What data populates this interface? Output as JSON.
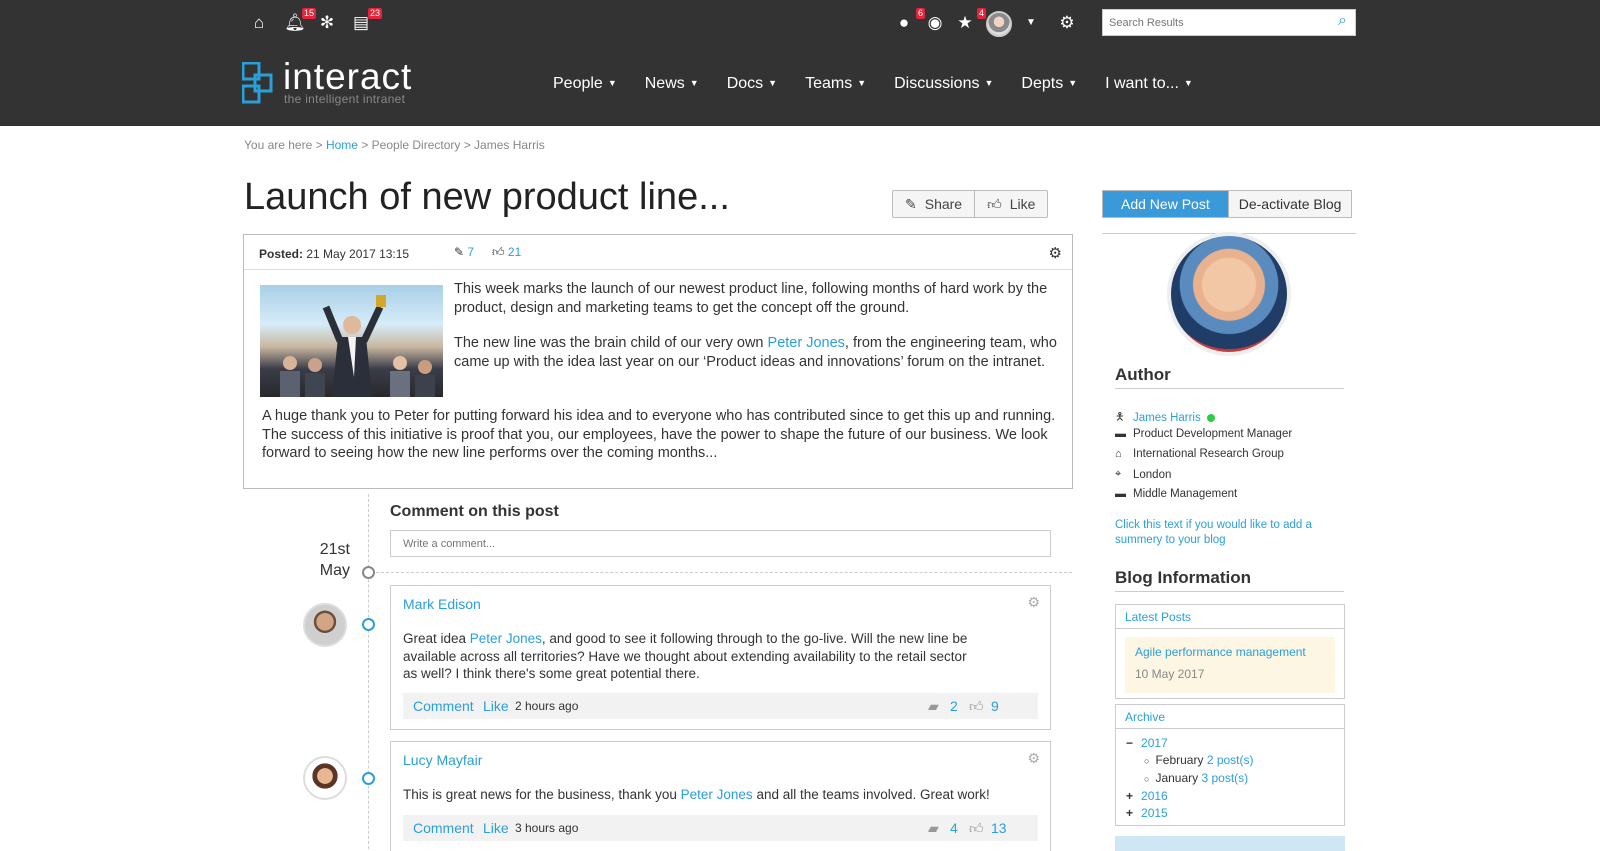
{
  "topbar": {
    "notifications_count": "15",
    "tasks_count": "23",
    "alerts_count": "6",
    "favourites_count": "4",
    "search_placeholder": "Search Results"
  },
  "logo": {
    "name": "interact",
    "tagline": "the intelligent intranet"
  },
  "nav": [
    {
      "label": "People"
    },
    {
      "label": "News"
    },
    {
      "label": "Docs"
    },
    {
      "label": "Teams"
    },
    {
      "label": "Discussions"
    },
    {
      "label": "Depts"
    },
    {
      "label": "I want to..."
    }
  ],
  "breadcrumb": {
    "prefix": "You are here >",
    "home": "Home",
    "rest": "> People Directory > James Harris"
  },
  "post": {
    "title": "Launch of new product line...",
    "share_label": "Share",
    "like_label": "Like",
    "posted_label": "Posted:",
    "posted_date": "21 May 2017 13:15",
    "edits": "7",
    "likes": "21",
    "para1": "This week marks the launch of our newest product line, following months of hard work by the product, design and marketing teams to get the concept off the ground.",
    "para2_a": "The new line was the brain child of our very own ",
    "para2_link": "Peter Jones",
    "para2_b": ", from the engineering team, who came up with the idea last year on our ‘Product ideas and innovations’ forum on the intranet.",
    "para3": "A huge thank you to Peter for putting forward his idea and to everyone who has contributed since to get this up and running. The success of this initiative is proof that you, our employees, have the power to shape the future of our business. We look forward to seeing how the new line performs over the coming months..."
  },
  "comments_section": {
    "heading": "Comment on this post",
    "placeholder": "Write a comment...",
    "date_day": "21st",
    "date_month": "May",
    "items": [
      {
        "author": "Mark Edison",
        "text_a": "Great idea ",
        "link": "Peter Jones",
        "text_b": ", and good to see it following through to the go-live. Will the new line be available across all territories? Have we thought about extending availability to the retail sector as well? I think there's some great potential there.",
        "comment_label": "Comment",
        "like_label": "Like",
        "time": "2 hours ago",
        "replies": "2",
        "likes": "9"
      },
      {
        "author": "Lucy Mayfair",
        "text_a": "This is great news for the business, thank you ",
        "link": "Peter Jones",
        "text_b": " and all the teams involved. Great work!",
        "comment_label": "Comment",
        "like_label": "Like",
        "time": "3 hours ago",
        "replies": "4",
        "likes": "13"
      }
    ]
  },
  "sidebar": {
    "add_post": "Add New Post",
    "deactivate": "De-activate Blog",
    "author_heading": "Author",
    "author": {
      "name": "James Harris",
      "role": "Product Development Manager",
      "company": "International Research Group",
      "location": "London",
      "level": "Middle Management"
    },
    "summary_hint": "Click this text if you would like to add a summery to your blog",
    "blog_info_heading": "Blog Information",
    "latest_posts_label": "Latest Posts",
    "latest_post": {
      "title": "Agile performance management",
      "date": "10 May 2017"
    },
    "archive_label": "Archive",
    "archive": {
      "y2017": "2017",
      "feb": "February",
      "feb_count": "2 post(s)",
      "jan": "January",
      "jan_count": "3 post(s)",
      "y2016": "2016",
      "y2015": "2015"
    }
  },
  "colors": {
    "topbar": "#333333",
    "accent": "#2a9fd8",
    "online": "#2ecc40",
    "badge": "#e3243b"
  }
}
